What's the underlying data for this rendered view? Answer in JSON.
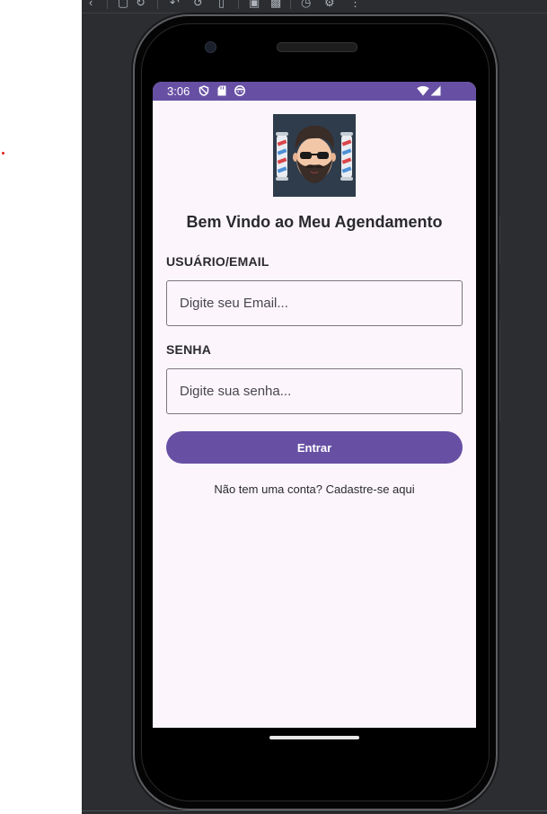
{
  "app": {
    "status_bar": {
      "time": "3:06"
    },
    "title": "Bem Vindo ao Meu Agendamento",
    "email_section": {
      "label": "USUÁRIO/EMAIL",
      "placeholder": "Digite seu Email...",
      "value": ""
    },
    "password_section": {
      "label": "SENHA",
      "placeholder": "Digite sua senha...",
      "value": ""
    },
    "login_button": {
      "label": "Entrar"
    },
    "signup_link": {
      "text": "Não tem uma conta? Cadastre-se aqui"
    }
  },
  "icons": [
    "back-icon",
    "device-icon",
    "refresh-icon",
    "undo-icon",
    "rotate-icon",
    "phone-icon",
    "screenshot-icon",
    "camera-icon",
    "clock-icon",
    "settings-icon",
    "more-icon",
    "shield-icon",
    "sd-card-icon",
    "face-icon",
    "wifi-icon",
    "signal-icon",
    "barber-logo"
  ],
  "colors": {
    "primary": "#6750a4",
    "background": "#fcf6fc",
    "logo_bg": "#2f3c4b",
    "ide_bg": "#2b2d30"
  }
}
